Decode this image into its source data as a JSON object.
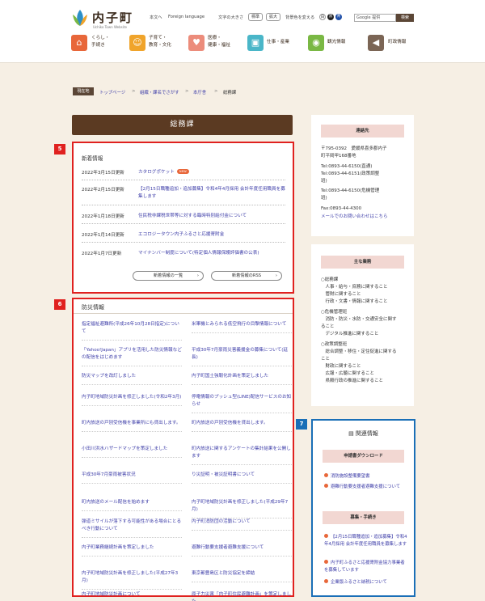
{
  "header": {
    "site_name": "内子町",
    "site_name_en": "Uchiko Town Website",
    "util": {
      "honbun": "本文へ",
      "foreign": "Foreign language",
      "font_size_label": "文字の大きさ",
      "font_standard": "標準",
      "font_large": "拡大",
      "bg_color_label": "背景色を変える",
      "color_white": "白",
      "color_black": "黒",
      "color_blue": "青",
      "search_placeholder": "Google 提供",
      "search_button": "検索"
    },
    "nav": [
      {
        "label": "くらし・\n手続き",
        "icon": "house-icon",
        "color": "#e8673a"
      },
      {
        "label": "子育て・\n教育・文化",
        "icon": "family-icon",
        "color": "#f0a42b"
      },
      {
        "label": "医療・\n健康・福祉",
        "icon": "heart-icon",
        "color": "#ec8c7b"
      },
      {
        "label": "仕事・産業",
        "icon": "briefcase-icon",
        "color": "#4ab6c8"
      },
      {
        "label": "観光情報",
        "icon": "camera-icon",
        "color": "#7ab844"
      },
      {
        "label": "町政情報",
        "icon": "megaphone-icon",
        "color": "#7b6555"
      }
    ]
  },
  "breadcrumb": {
    "current_label": "現在地",
    "items": [
      "トップページ",
      "組織・課名でさがす",
      "本庁舎",
      "総務課"
    ]
  },
  "page_title": "総務課",
  "news": {
    "heading": "新着情報",
    "new_badge": "NEW",
    "items": [
      {
        "date": "2022年3月15日更新",
        "title": "カタログポケット",
        "is_new": true
      },
      {
        "date": "2022年2月15日更新",
        "title": "【2月15日職種追加・追加募集】令和4年4月採用 会計年度任用職員を募集します",
        "is_new": false
      },
      {
        "date": "2022年1月18日更新",
        "title": "住民税非課税世帯等に対する臨時特別給付金について",
        "is_new": false
      },
      {
        "date": "2022年1月14日更新",
        "title": "エコロジータウン内子ふるさと応援寄附金",
        "is_new": false
      },
      {
        "date": "2022年1月7日更新",
        "title": "マイナンバー制度について(特定個人情報保護評価書の公表)",
        "is_new": false
      }
    ],
    "list_button": "新着情報の一覧",
    "rss_button": "新着情報のRSS"
  },
  "disaster": {
    "heading": "防災情報",
    "items": [
      "指定福祉避難所(平成26年10月28日指定)について",
      "米軍機とみられる低空飛行の目撃情報について",
      "「Yahoo!Japan」アプリを活用した防災情報などの配信をはじめます",
      "平成30年7月豪雨災害義援金の募集について(延長)",
      "防災マップを改訂しました",
      "内子町国土強靭化計画を策定しました",
      "内子町地域防災計画を修正しました(令和2年3月)",
      "停電情報のプッシュ型(LINE)配信サービスのお知らせ",
      "町内放送の戸別受信機を事業所にも貸出します。",
      "町内放送の戸別受信機を貸出します。",
      "小田川洪水ハザードマップを策定しました",
      "町内放送に関するアンケートの集計結果を公開します",
      "平成30年7月豪雨被害状況",
      "り災証明・被災証明書について",
      "町内放送のメール配信を始めます",
      "内子町地域防災計画を修正しました(平成29年7月)",
      "弾道ミサイルが落下する可能性がある場合にとるべき行動について",
      "内子町消防団の活動について",
      "内子町業務継続計画を策定しました",
      "避難行動要支援者避難支援について",
      "内子町地域防災計画を修正しました(平成27年3月)",
      "東京都豊島区と防災協定を締結",
      "内子町地域防災計画について",
      "原子力災害「内子町住民避難計画」を策定しました"
    ]
  },
  "contact": {
    "heading": "連絡先",
    "address1": "〒795-0392　愛媛県喜多郡内子",
    "address2": "町平岡甲168番地",
    "tel1": "Tel:0893-44-6150(直通)",
    "tel2": "Tel:0893-44-6151(政策調整",
    "tel2b": "班)",
    "tel3": "Tel:0893-44-6150(危機管理",
    "tel3b": "班)",
    "fax": "Fax:0893-44-4300",
    "mail_link": "メールでのお問い合わせはこちら"
  },
  "duties": {
    "heading": "主な業務",
    "lines": [
      "○総務課",
      "　人事・給与・庶務に関すること",
      "　管財に関すること",
      "　行政・文書・情報に関すること",
      "",
      "○危機管理班",
      "　消防・防災・水防・交通安全に関す",
      "ること",
      "　デジタル推進に関すること",
      "",
      "○政策調整班",
      "　総合調整・移住・定住促進に関する",
      "こと",
      "　財政に関すること",
      "　広報・広聴に関すること",
      "　県殿行政の推進に関すること"
    ]
  },
  "related": {
    "heading": "関連情報",
    "download_heading": "申請書ダウンロード",
    "download_links": [
      "消防施設整備要望書",
      "避難行動要支援者避難支援について"
    ],
    "recruit_heading": "募集・手続き",
    "recruit_links": [
      "【2月15日職種追加・追加募集】令和4年4月採用 会計年度任用職員を募集します",
      "内子町ふるさと応援寄附金協力事業者を募集しています",
      "企業版ふるさと納税について"
    ]
  },
  "annotations": {
    "news": "5",
    "disaster": "6",
    "related": "7"
  }
}
